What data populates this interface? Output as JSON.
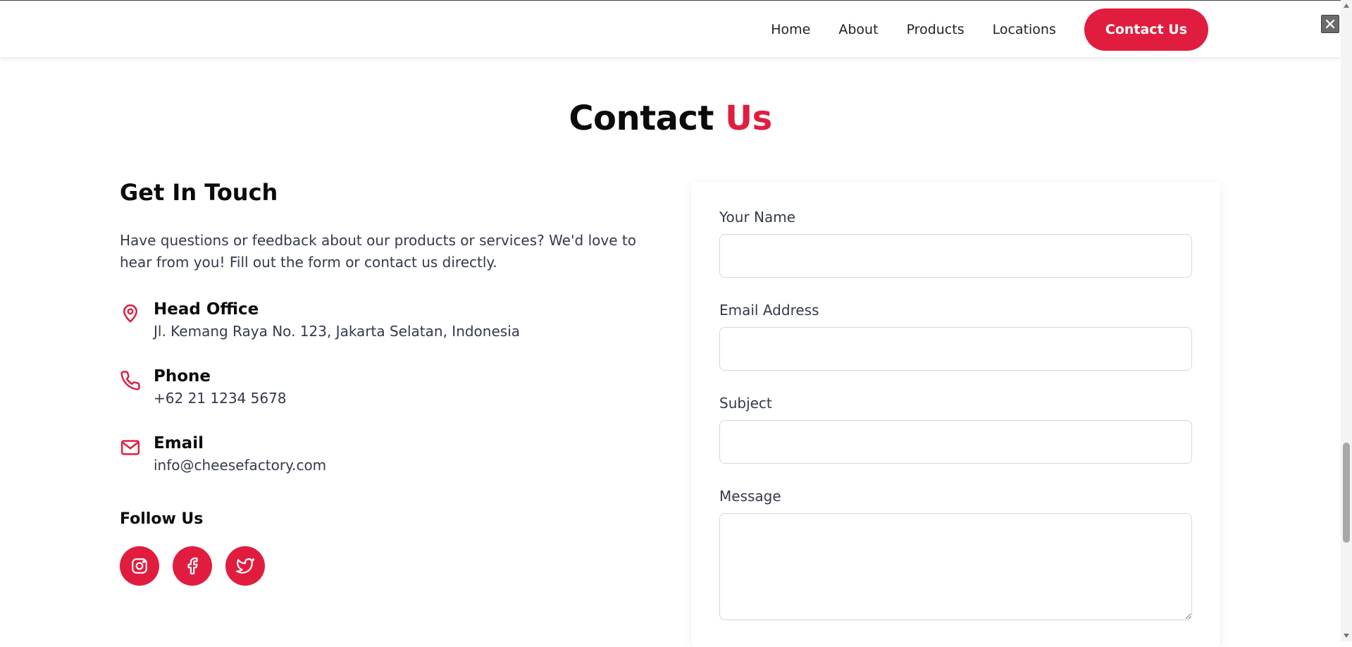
{
  "nav": {
    "items": [
      "Home",
      "About",
      "Products",
      "Locations"
    ],
    "cta": "Contact Us"
  },
  "page_title": {
    "main": "Contact",
    "accent": "Us"
  },
  "get_in_touch": {
    "heading": "Get In Touch",
    "intro": "Have questions or feedback about our products or services? We'd love to hear from you! Fill out the form or contact us directly.",
    "items": [
      {
        "icon": "map-pin-icon",
        "title": "Head Office",
        "value": "Jl. Kemang Raya No. 123, Jakarta Selatan, Indonesia"
      },
      {
        "icon": "phone-icon",
        "title": "Phone",
        "value": "+62 21 1234 5678"
      },
      {
        "icon": "mail-icon",
        "title": "Email",
        "value": "info@cheesefactory.com"
      }
    ],
    "follow_label": "Follow Us",
    "socials": [
      "instagram-icon",
      "facebook-icon",
      "twitter-icon"
    ]
  },
  "form": {
    "name_label": "Your Name",
    "name_value": "",
    "email_label": "Email Address",
    "email_value": "",
    "subject_label": "Subject",
    "subject_value": "",
    "message_label": "Message",
    "message_value": ""
  },
  "colors": {
    "accent": "#e11d3f",
    "text": "#0b0b0b",
    "muted": "#333a4a"
  }
}
